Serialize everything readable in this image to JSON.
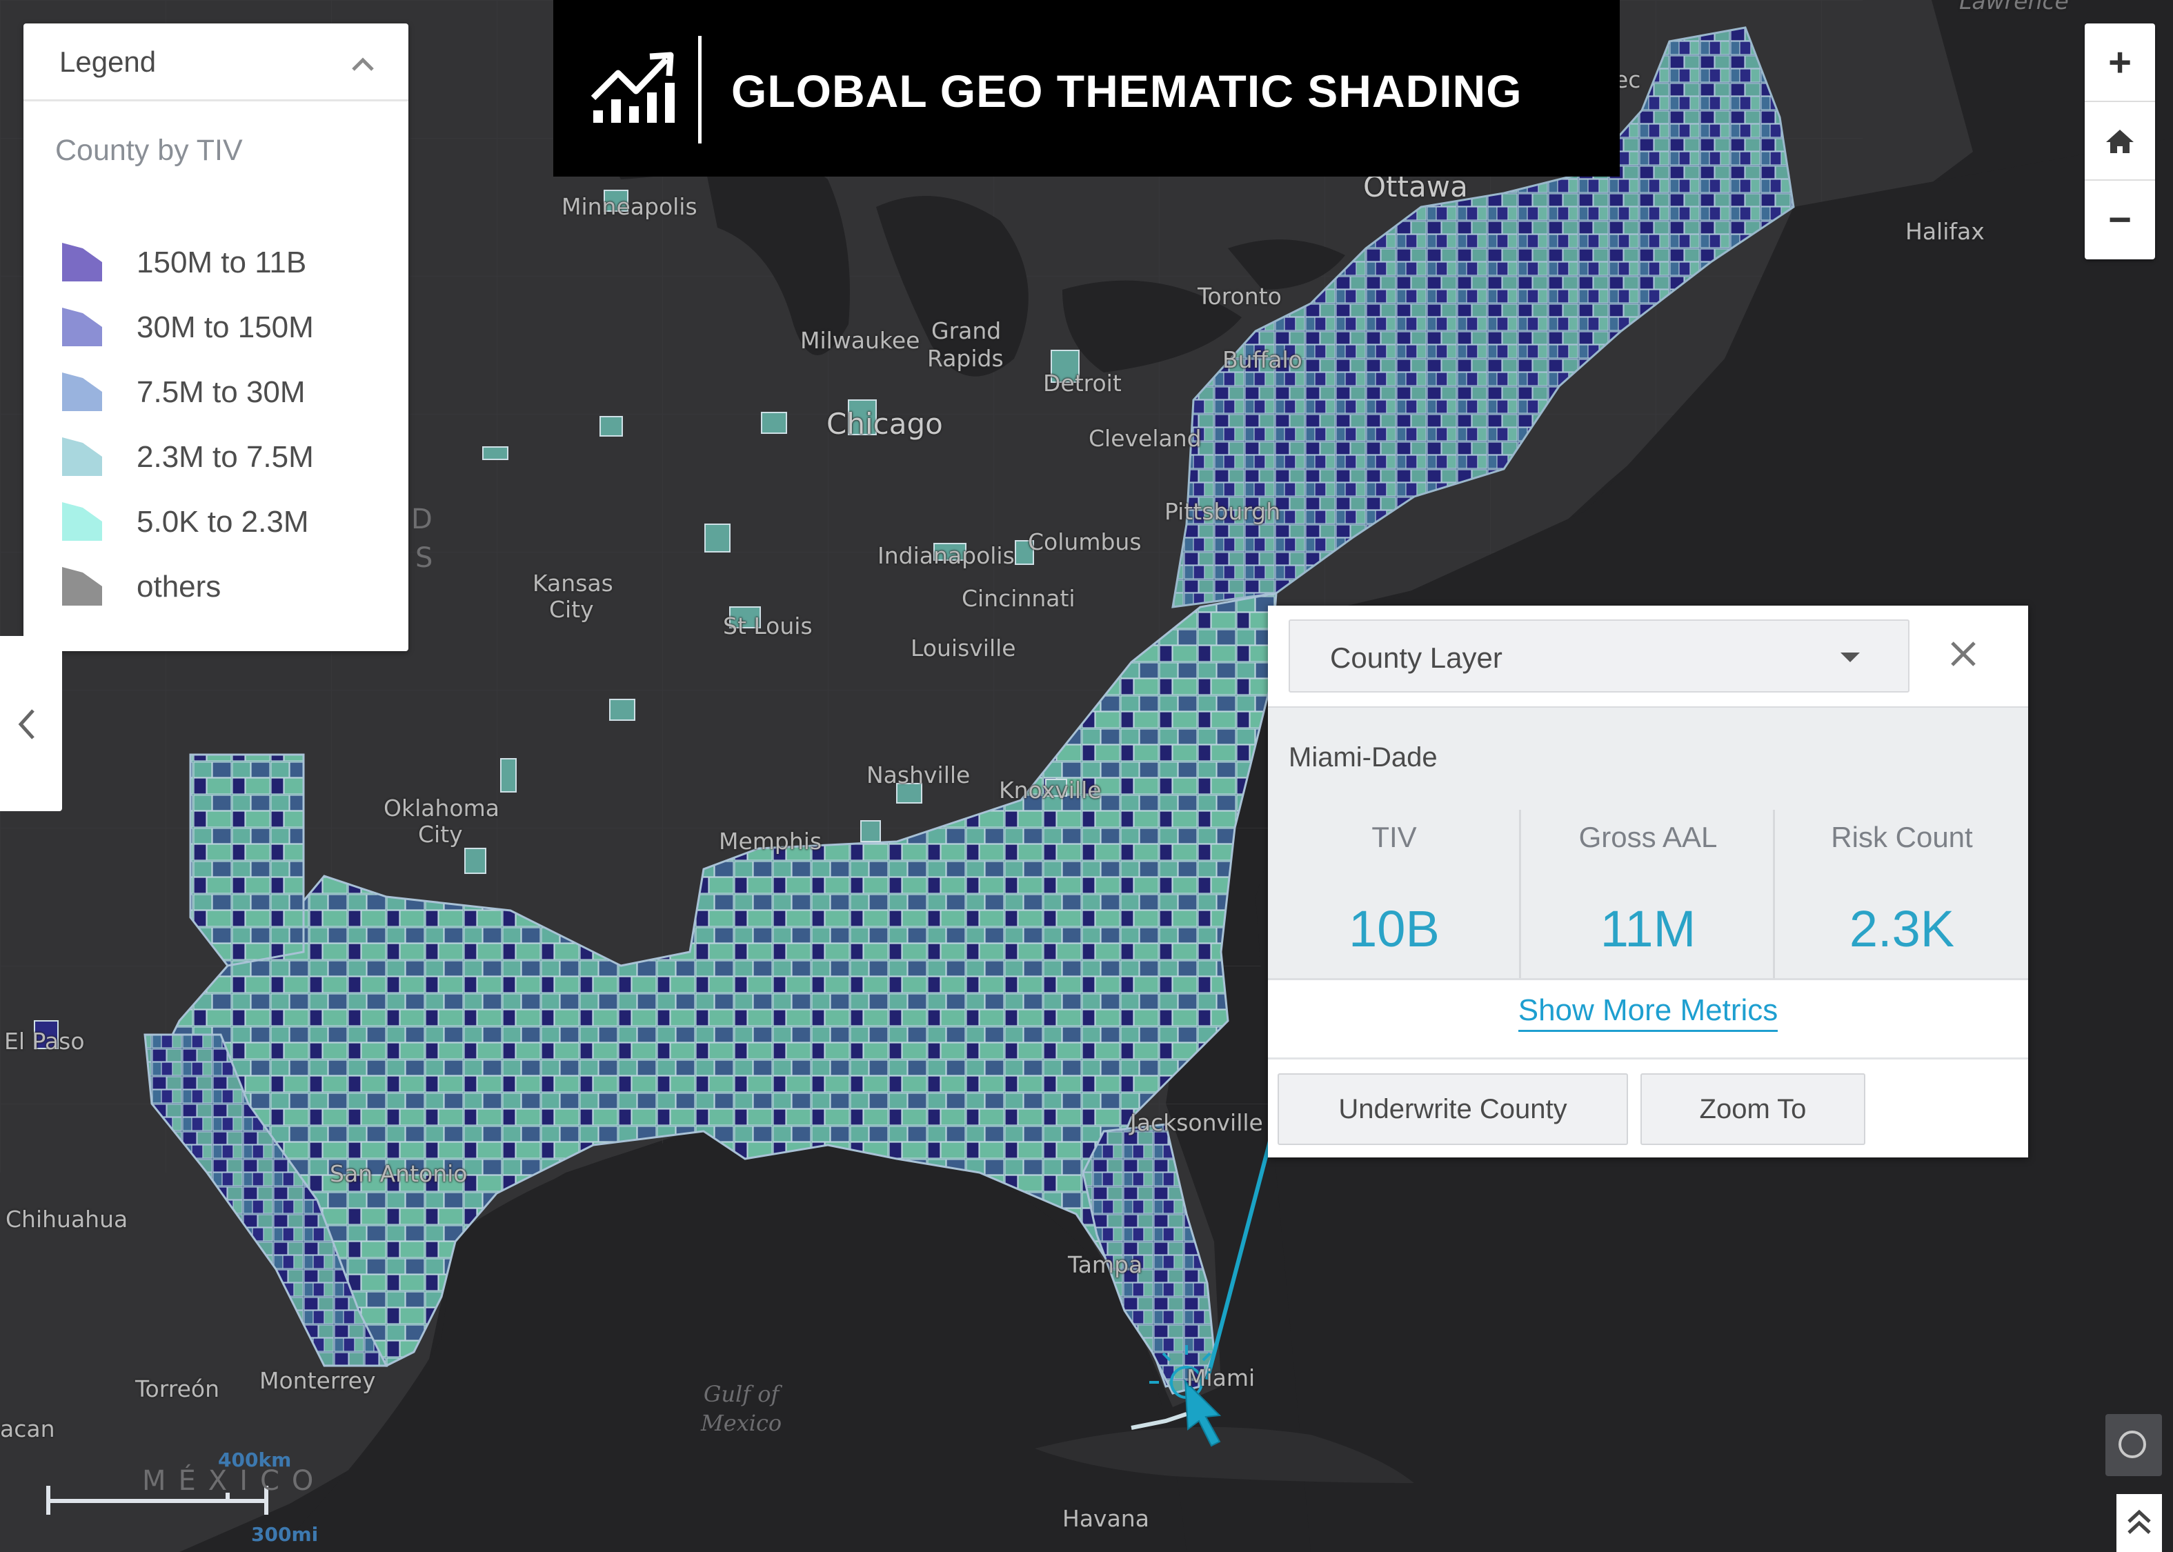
{
  "title": "GLOBAL GEO THEMATIC SHADING",
  "legend": {
    "title": "Legend",
    "subtitle": "County by TIV",
    "items": [
      {
        "label": "150M to 11B",
        "color": "#7a6bc4"
      },
      {
        "label": "30M to 150M",
        "color": "#8b8fd4"
      },
      {
        "label": "7.5M to 30M",
        "color": "#99b3de"
      },
      {
        "label": "2.3M to 7.5M",
        "color": "#a9d7de"
      },
      {
        "label": "5.0K to 2.3M",
        "color": "#a8f2e8"
      },
      {
        "label": "others",
        "color": "#8f8f8f"
      }
    ]
  },
  "map": {
    "colors": {
      "background": "#2c2c2e",
      "ocean": "#232325",
      "county_fills": [
        "#232276",
        "#3e5a88",
        "#5fa49a",
        "#4b8a99",
        "#2f2f86"
      ]
    },
    "labels": {
      "minneapolis": "Minneapolis",
      "ottawa": "Ottawa",
      "halifax": "Halifax",
      "toronto": "Toronto",
      "milwaukee": "Milwaukee",
      "grand_rapids_1": "Grand",
      "grand_rapids_2": "Rapids",
      "detroit": "Detroit",
      "chicago": "Chicago",
      "cleveland": "Cleveland",
      "buffalo": "Buffalo",
      "kansas_city_1": "Kansas",
      "kansas_city_2": "City",
      "indianapolis": "Indianapolis",
      "columbus": "Columbus",
      "st_louis": "St Louis",
      "cincinnati": "Cincinnati",
      "louisville": "Louisville",
      "nashville": "Nashville",
      "knoxville": "Knoxville",
      "oklahoma_city_1": "Oklahoma",
      "oklahoma_city_2": "City",
      "memphis": "Memphis",
      "el_paso": "El Paso",
      "chihuahua": "Chihuahua",
      "san_antonio": "San Antonio",
      "jacksonville": "Jacksonville",
      "tampa": "Tampa",
      "miami": "Miami",
      "torreon": "Torreón",
      "monterrey": "Monterrey",
      "acan": "acan",
      "havana": "Havana",
      "gulf_1": "Gulf of",
      "gulf_2": "Mexico",
      "mexico": "MÉXICO",
      "lawrence": "Lawrence",
      "pittsburgh": "Pittsburgh",
      "ec": "ec",
      "us_d": "D",
      "us_s": "S"
    },
    "scale": {
      "km": "400km",
      "mi": "300mi"
    }
  },
  "controls": {
    "zoom_in": "+",
    "home": "home-icon",
    "zoom_out": "−"
  },
  "popup": {
    "layer_select": "County Layer",
    "close": "×",
    "feature_name": "Miami-Dade",
    "metrics": [
      {
        "label": "TIV",
        "value": "10B"
      },
      {
        "label": "Gross AAL",
        "value": "11M"
      },
      {
        "label": "Risk Count",
        "value": "2.3K"
      }
    ],
    "show_more": "Show More Metrics",
    "actions": {
      "underwrite": "Underwrite County",
      "zoom_to": "Zoom To"
    },
    "accent": "#1aa3c6"
  }
}
